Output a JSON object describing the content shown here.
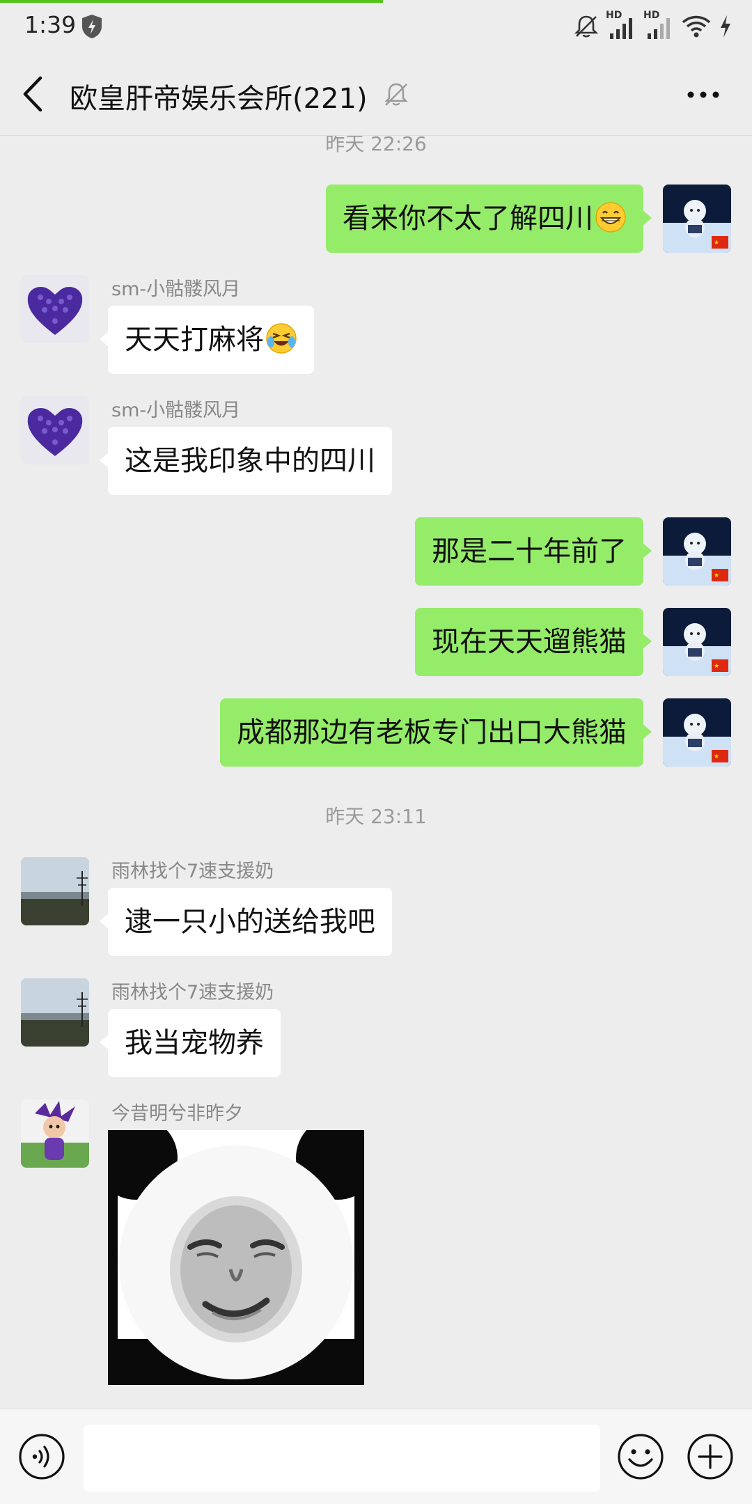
{
  "status": {
    "time": "1:39",
    "signal_label_1": "HD",
    "signal_label_2": "HD"
  },
  "header": {
    "title": "欧皇肝帝娱乐会所(221)"
  },
  "messages": {
    "time_1": "昨天 22:26",
    "m1": "看来你不太了解四川",
    "m2_sender": "sm-小骷髅风月",
    "m2": "天天打麻将",
    "m3_sender": "sm-小骷髅风月",
    "m3": "这是我印象中的四川",
    "m4": "那是二十年前了",
    "m5": "现在天天遛熊猫",
    "m6": "成都那边有老板专门出口大熊猫",
    "time_2": "昨天 23:11",
    "m7_sender": "雨林找个7速支援奶",
    "m7": "逮一只小的送给我吧",
    "m8_sender": "雨林找个7速支援奶",
    "m8": "我当宠物养",
    "m9_sender": "今昔明兮非昨夕"
  },
  "colors": {
    "outgoing_bubble": "#95ec69",
    "incoming_bubble": "#ffffff",
    "background": "#ededed",
    "progress": "#52c41a"
  },
  "icons": [
    "back-arrow-icon",
    "mute-bell-icon",
    "more-icon",
    "voice-icon",
    "emoji-icon",
    "plus-icon"
  ]
}
